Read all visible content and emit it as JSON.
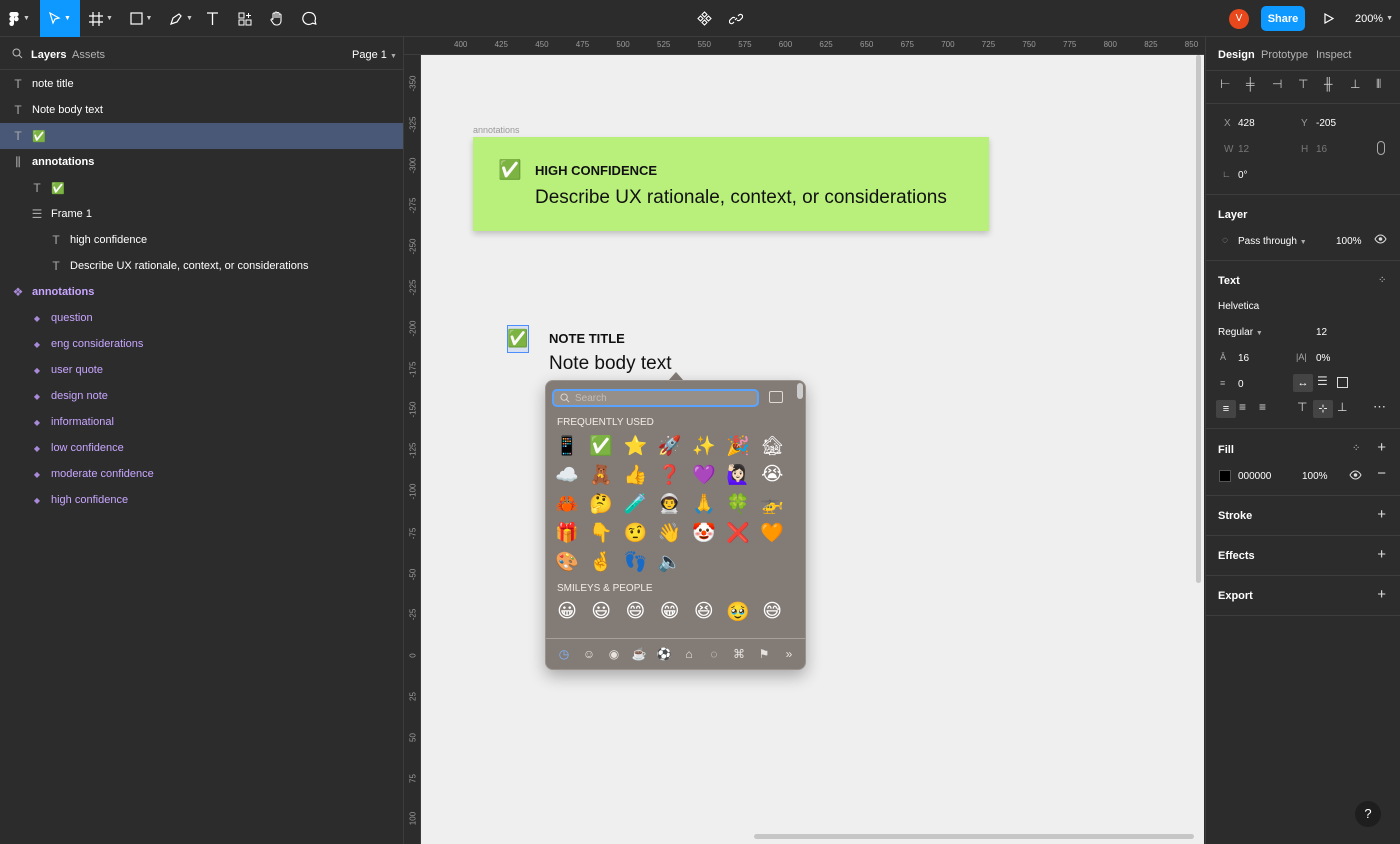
{
  "toolbar": {
    "share_label": "Share",
    "zoom_label": "200%",
    "avatar_initial": "V",
    "accent": "#0d99ff",
    "avatar_color": "#e8481c"
  },
  "left_panel": {
    "tabs": [
      "Layers",
      "Assets"
    ],
    "page_label": "Page 1",
    "layers": [
      {
        "label": "note title",
        "icon": "text-icon"
      },
      {
        "label": "Note body text",
        "icon": "text-icon"
      },
      {
        "label": "✅",
        "icon": "text-icon"
      },
      {
        "label": "annotations",
        "icon": "frame-icon"
      },
      {
        "label": "✅",
        "icon": "text-icon"
      },
      {
        "label": "Frame 1",
        "icon": "autolayout-icon"
      },
      {
        "label": "high confidence",
        "icon": "text-icon"
      },
      {
        "label": "Describe UX rationale, context, or considerations",
        "icon": "text-icon"
      },
      {
        "label": "annotations",
        "icon": "component-set-icon"
      },
      {
        "label": "question",
        "icon": "component-icon"
      },
      {
        "label": "eng considerations",
        "icon": "component-icon"
      },
      {
        "label": "user quote",
        "icon": "component-icon"
      },
      {
        "label": "design note",
        "icon": "component-icon"
      },
      {
        "label": "informational",
        "icon": "component-icon"
      },
      {
        "label": "low confidence",
        "icon": "component-icon"
      },
      {
        "label": "moderate confidence",
        "icon": "component-icon"
      },
      {
        "label": "high confidence",
        "icon": "component-icon"
      }
    ]
  },
  "rulers": {
    "top": [
      "400",
      "425",
      "450",
      "475",
      "500",
      "525",
      "550",
      "575",
      "600",
      "625",
      "650",
      "675",
      "700",
      "725",
      "750",
      "775",
      "800",
      "825",
      "850"
    ],
    "left": [
      "-350",
      "-325",
      "-300",
      "-275",
      "-250",
      "-225",
      "-200",
      "-175",
      "-150",
      "-125",
      "-100",
      "-75",
      "-50",
      "-25",
      "0",
      "25",
      "50",
      "75",
      "100"
    ]
  },
  "canvas": {
    "frame_label": "annotations",
    "card": {
      "emoji": "✅",
      "title": "HIGH CONFIDENCE",
      "body": "Describe UX rationale, context, or considerations"
    },
    "note": {
      "emoji": "✅",
      "title": "NOTE TITLE",
      "body": "Note body text"
    }
  },
  "emoji_picker": {
    "search_placeholder": "Search",
    "section_frequent": "FREQUENTLY USED",
    "section_smileys": "SMILEYS & PEOPLE",
    "frequent": [
      "📱",
      "✅",
      "⭐",
      "🚀",
      "✨",
      "🎉",
      "🏚",
      "☁️",
      "🧸",
      "👍",
      "❓",
      "💜",
      "🙋🏻‍♀️",
      "😭",
      "🦀",
      "🤔",
      "🧪",
      "👨‍🚀",
      "🙏",
      "🍀",
      "🚁",
      "🎁",
      "👇",
      "🤨",
      "👋",
      "🤡",
      "❌",
      "🧡",
      "🎨",
      "🤞",
      "👣",
      "🔈"
    ],
    "smileys": [
      "😀",
      "😃",
      "😄",
      "😁",
      "😆",
      "🥹",
      "😅"
    ]
  },
  "right_panel": {
    "tabs": [
      "Design",
      "Prototype",
      "Inspect"
    ],
    "x_label": "X",
    "x_value": "428",
    "y_label": "Y",
    "y_value": "-205",
    "w_label": "W",
    "w_value": "12",
    "h_label": "H",
    "h_value": "16",
    "rotation": "0°",
    "layer_title": "Layer",
    "blend_mode": "Pass through",
    "opacity": "100%",
    "text_title": "Text",
    "font_family": "Helvetica",
    "font_weight": "Regular",
    "font_size": "12",
    "line_height": "16",
    "letter_spacing": "0%",
    "paragraph_spacing": "0",
    "fill_title": "Fill",
    "fill_hex": "000000",
    "fill_opacity": "100%",
    "stroke_title": "Stroke",
    "effects_title": "Effects",
    "export_title": "Export"
  }
}
